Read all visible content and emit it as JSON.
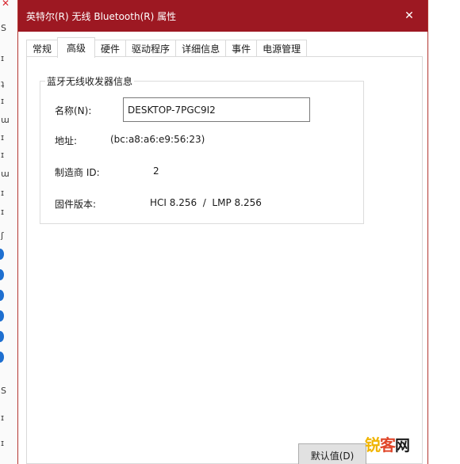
{
  "window": {
    "title": "英特尔(R) 无线 Bluetooth(R) 属性",
    "close_glyph": "✕"
  },
  "tabs": [
    {
      "label": "常规"
    },
    {
      "label": "高级"
    },
    {
      "label": "硬件"
    },
    {
      "label": "驱动程序"
    },
    {
      "label": "详细信息"
    },
    {
      "label": "事件"
    },
    {
      "label": "电源管理"
    }
  ],
  "active_tab": "高级",
  "group": {
    "title": "蓝牙无线收发器信息",
    "name_label": "名称(N):",
    "name_value": "DESKTOP-7PGC9I2",
    "address_label": "地址:",
    "address_value": "(bc:a8:a6:e9:56:23)",
    "manufacturer_label": "制造商 ID:",
    "manufacturer_value": "2",
    "firmware_label": "固件版本:",
    "firmware_value": "HCI 8.256  /  LMP 8.256"
  },
  "buttons": {
    "default_label": "默认值(D)"
  },
  "watermark": {
    "part1": "锐",
    "part2": "客",
    "part3": "网"
  },
  "background_strip": {
    "glyphs": [
      "S",
      "ɪ",
      "ʇ",
      "ɪ",
      "ɯ",
      "ɪ",
      "ɪ",
      "ɯ",
      "ɪ",
      "ɪ",
      "ʃ",
      "S",
      "ɪ",
      "ɪ"
    ]
  },
  "colors": {
    "titlebar": "#9d1822",
    "accent_blue": "#1e6fd0"
  }
}
